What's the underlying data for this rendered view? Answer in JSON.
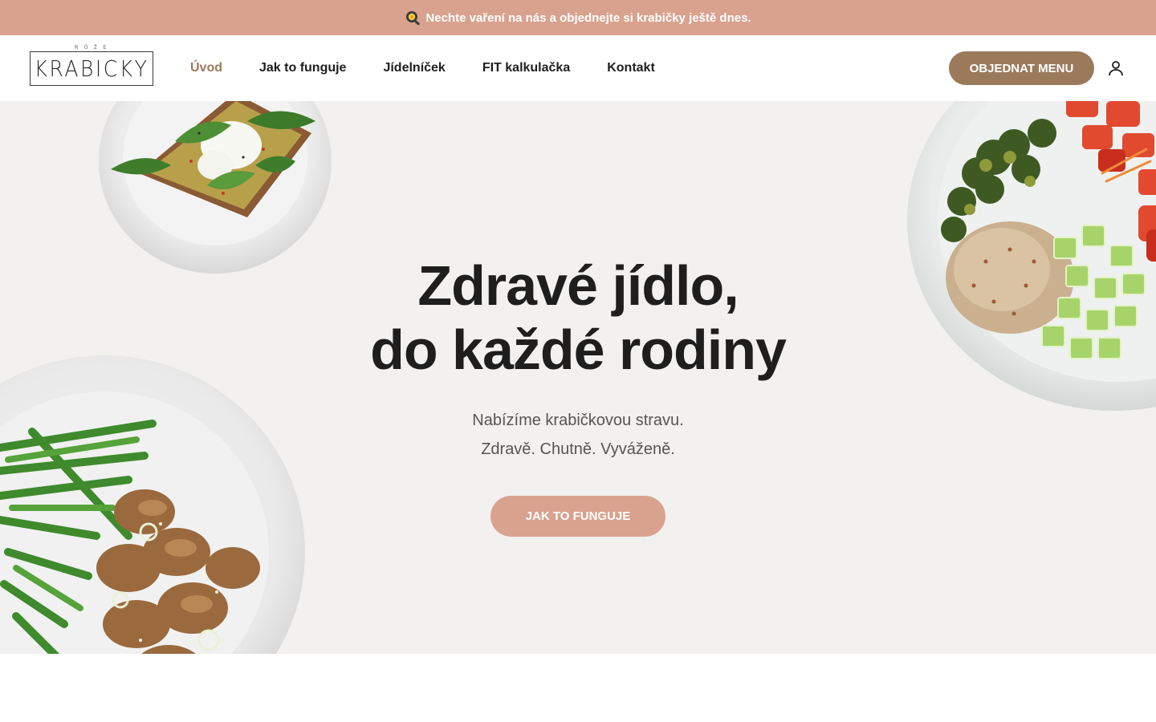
{
  "announcement": {
    "icon": "frying-pan-icon",
    "text": "Nechte vaření na nás a objednejte si krabičky ještě dnes."
  },
  "header": {
    "logo": {
      "text": "KRABICKY",
      "subtitle": "R Ů Ž E"
    },
    "nav": [
      {
        "label": "Úvod",
        "active": true
      },
      {
        "label": "Jak to funguje",
        "active": false
      },
      {
        "label": "Jídelníček",
        "active": false
      },
      {
        "label": "FIT kalkulačka",
        "active": false
      },
      {
        "label": "Kontakt",
        "active": false
      }
    ],
    "order_button": "OBJEDNAT MENU",
    "account_icon": "user-icon"
  },
  "hero": {
    "title_line1": "Zdravé jídlo,",
    "title_line2": "do každé rodiny",
    "subtitle_line1": "Nabízíme krabičkovou stravu.",
    "subtitle_line2": "Zdravě. Chutně. Vyváženě.",
    "cta": "JAK TO FUNGUJE"
  },
  "colors": {
    "announcement_bg": "#d9a28f",
    "accent_brown": "#9b7a5c",
    "cta_pink": "#d9a28f",
    "hero_bg": "#f2f1ef",
    "text_dark": "#1e1e1e"
  }
}
